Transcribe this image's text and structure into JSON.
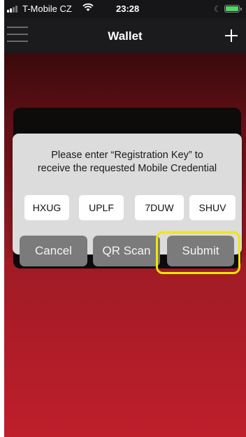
{
  "status_bar": {
    "carrier": "T-Mobile CZ",
    "time": "23:28",
    "wifi_icon": "wifi-icon",
    "battery_icon": "battery-charging-icon",
    "moon_icon": "do-not-disturb-icon",
    "battery_color": "#4cd964"
  },
  "nav": {
    "title": "Wallet",
    "menu_icon": "hamburger-menu-icon",
    "add_icon": "plus-icon"
  },
  "dialog": {
    "message_line1": "Please enter “Registration Key” to",
    "message_line2": "receive the requested Mobile Credential",
    "key_fields": [
      "HXUG",
      "UPLF",
      "7DUW",
      "SHUV"
    ],
    "buttons": {
      "cancel": "Cancel",
      "qr_scan": "QR Scan",
      "submit": "Submit"
    }
  },
  "colors": {
    "highlight": "#f2e600",
    "background_bottom": "#be1f2b",
    "button_gray": "#7b7b7b"
  }
}
